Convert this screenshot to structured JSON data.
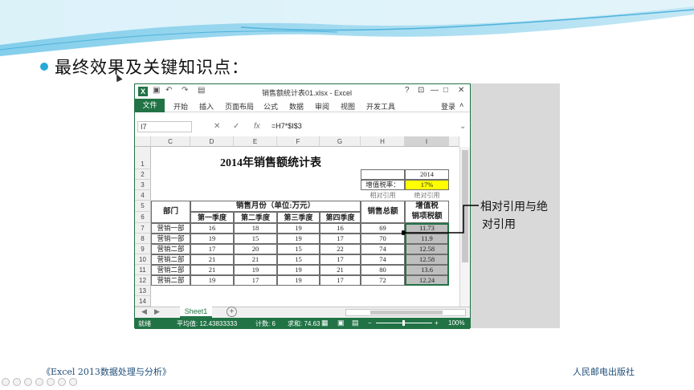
{
  "slide": {
    "heading": "最终效果及关键知识点：",
    "callout_line1": "相对引用与绝",
    "callout_line2": "对引用",
    "footer_left": "《Excel 2013数据处理与分析》",
    "footer_right": "人民邮电出版社",
    "colors": {
      "bullet": "#27a9d6",
      "excel_green": "#217346",
      "tax_rate_fill": "#ffff00",
      "selection_fill": "#bfbfbf"
    }
  },
  "excel": {
    "window_title": "销售额统计表01.xlsx - Excel",
    "window_buttons": [
      "?",
      "⊡",
      "—",
      "□",
      "✕"
    ],
    "ribbon_tabs": [
      "文件",
      "开始",
      "插入",
      "页面布局",
      "公式",
      "数据",
      "审阅",
      "视图",
      "开发工具"
    ],
    "login": "登录",
    "name_box": "I7",
    "formula": "=H7*$I$3",
    "columns": [
      "C",
      "D",
      "E",
      "F",
      "G",
      "H",
      "I"
    ],
    "rows": [
      "1",
      "2",
      "3",
      "4",
      "5",
      "6",
      "7",
      "8",
      "9",
      "10",
      "11",
      "12",
      "13",
      "14"
    ],
    "sheet_title": "2014年销售额统计表",
    "year": "2014",
    "tax_rate_label": "增值税率：",
    "tax_rate": "17%",
    "note_relative": "相对引用",
    "note_absolute": "绝对引用",
    "header": {
      "dept": "部门",
      "months": "销售月份（单位:万元）",
      "q1": "第一季度",
      "q2": "第二季度",
      "q3": "第三季度",
      "q4": "第四季度",
      "total": "销售总额",
      "vat_line1": "增值税",
      "vat_line2": "销项税额"
    },
    "data_rows": [
      {
        "dept": "营销一部",
        "q1": "16",
        "q2": "18",
        "q3": "19",
        "q4": "16",
        "total": "69",
        "vat": "11.73"
      },
      {
        "dept": "营销一部",
        "q1": "19",
        "q2": "15",
        "q3": "19",
        "q4": "17",
        "total": "70",
        "vat": "11.9"
      },
      {
        "dept": "营销二部",
        "q1": "17",
        "q2": "20",
        "q3": "15",
        "q4": "22",
        "total": "74",
        "vat": "12.58"
      },
      {
        "dept": "营销二部",
        "q1": "21",
        "q2": "21",
        "q3": "15",
        "q4": "17",
        "total": "74",
        "vat": "12.58"
      },
      {
        "dept": "营销二部",
        "q1": "21",
        "q2": "19",
        "q3": "19",
        "q4": "21",
        "total": "80",
        "vat": "13.6"
      },
      {
        "dept": "营销二部",
        "q1": "19",
        "q2": "17",
        "q3": "19",
        "q4": "17",
        "total": "72",
        "vat": "12.24"
      }
    ],
    "sheet_tab": "Sheet1",
    "status": {
      "ready": "就绪",
      "average": "平均值: 12.43833333",
      "count": "计数: 6",
      "sum": "求和: 74.63",
      "zoom": "100%"
    }
  }
}
